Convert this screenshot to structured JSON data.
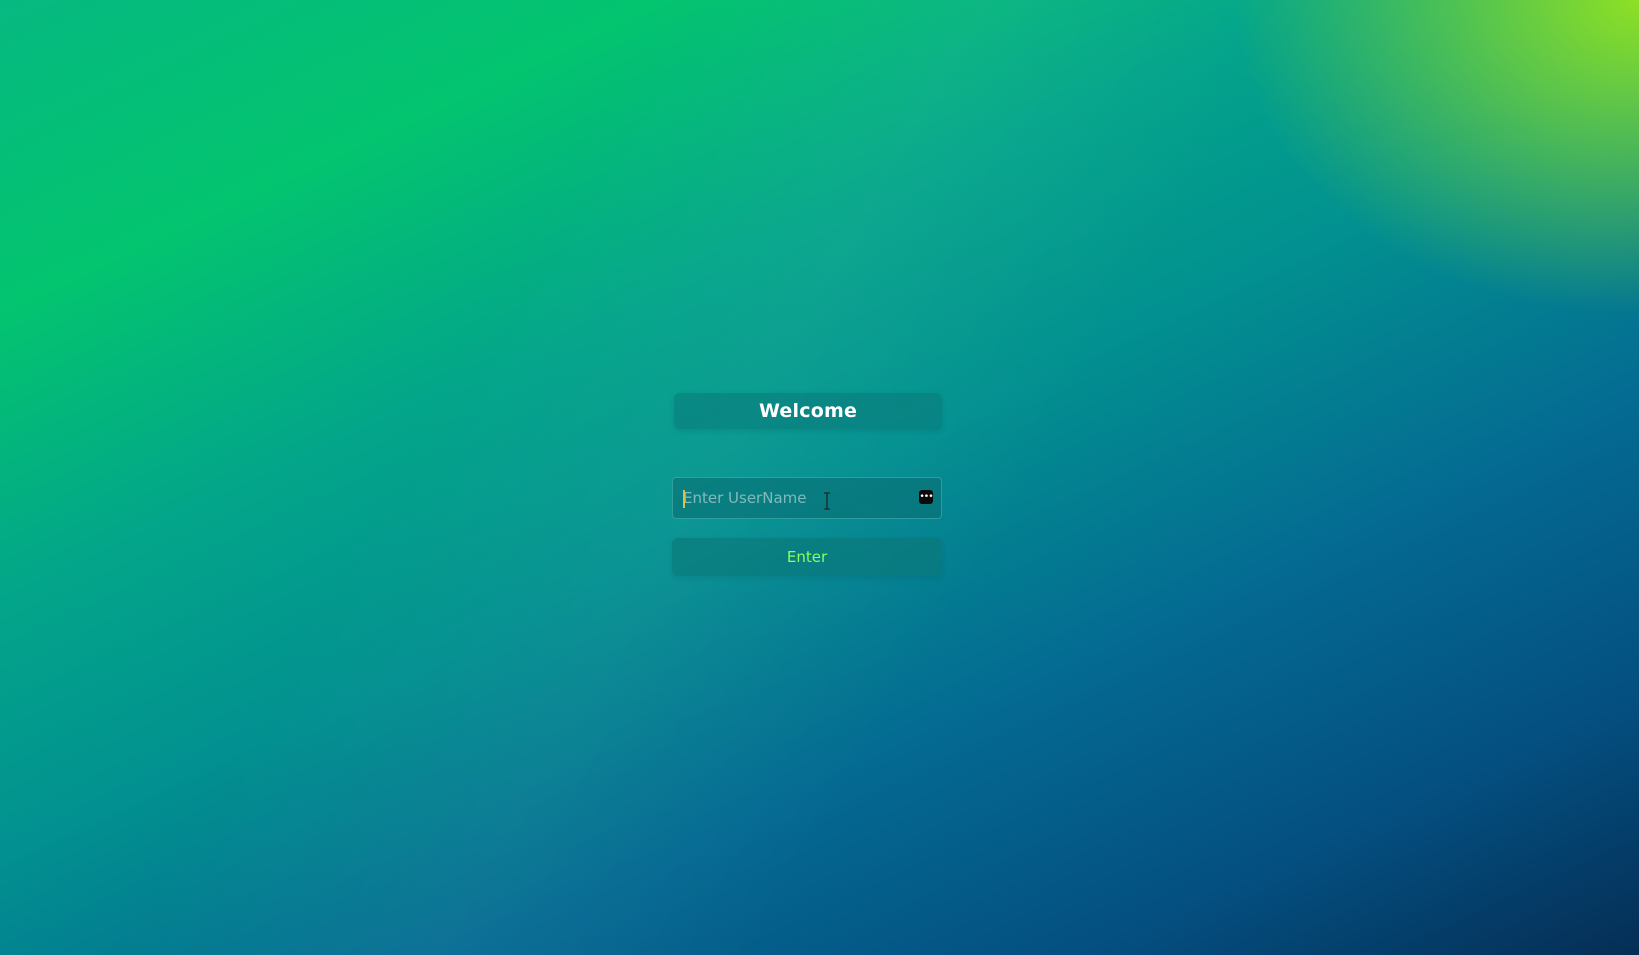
{
  "login": {
    "title": "Welcome",
    "username_placeholder": "Enter UserName",
    "username_value": "",
    "submit_label": "Enter"
  },
  "icons": {
    "input_trailing": "password-manager-key-icon",
    "pointer": "text-cursor-icon"
  },
  "colors": {
    "background_top_right": "#8ee024",
    "background_mid": "#029090",
    "background_bottom_left": "#052e55",
    "button_text": "#8cff5a",
    "title_text": "#ffffff"
  }
}
